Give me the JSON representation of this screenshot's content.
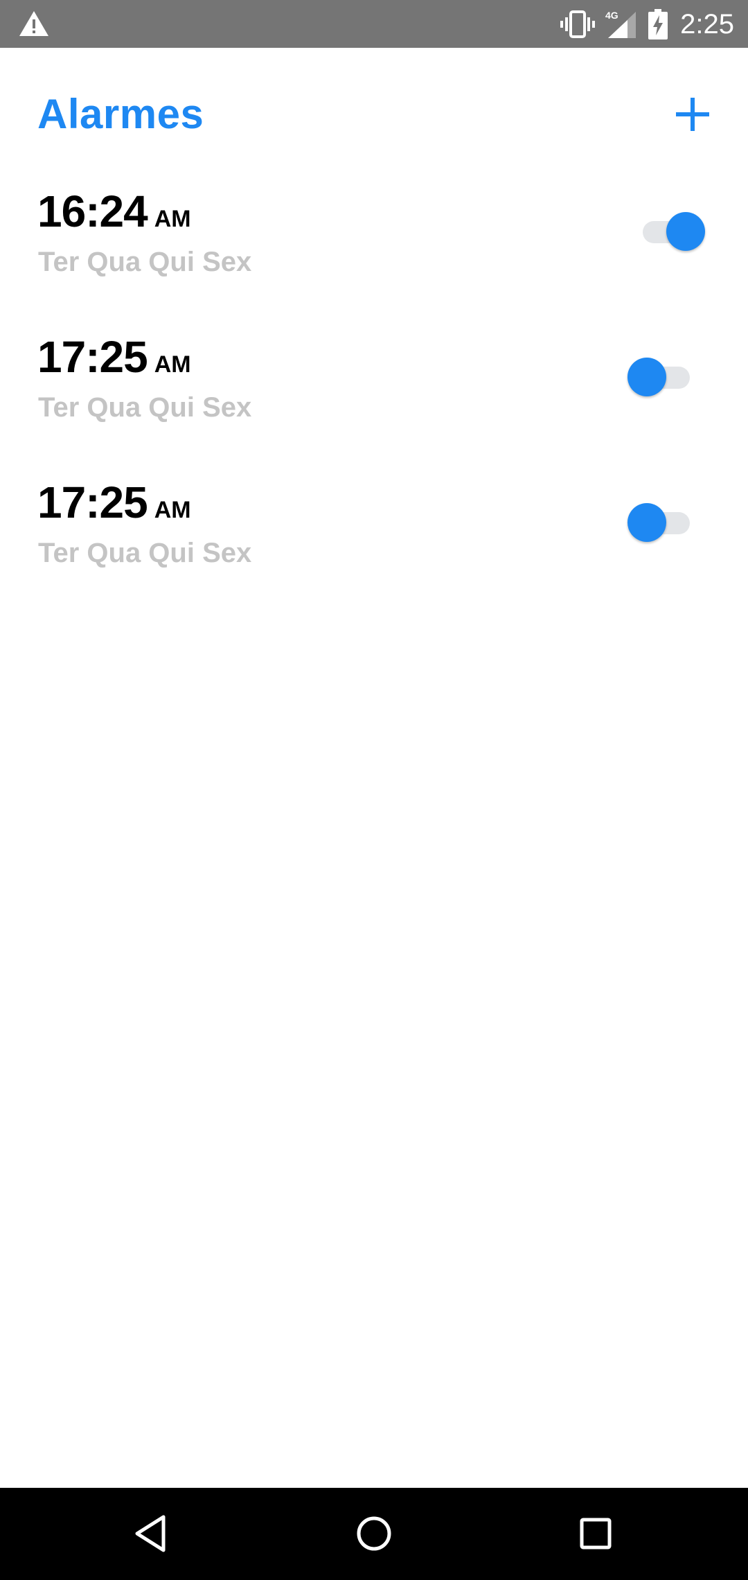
{
  "status_bar": {
    "time": "2:25",
    "network": "4G",
    "icons": [
      "warning-icon",
      "vibrate-icon",
      "signal-icon",
      "battery-charging-icon"
    ]
  },
  "header": {
    "title": "Alarmes",
    "add_icon": "plus-icon"
  },
  "alarms": [
    {
      "time": "16:24",
      "ampm": "AM",
      "days": "Ter Qua Qui Sex",
      "enabled": true
    },
    {
      "time": "17:25",
      "ampm": "AM",
      "days": "Ter Qua Qui Sex",
      "enabled": false
    },
    {
      "time": "17:25",
      "ampm": "AM",
      "days": "Ter Qua Qui Sex",
      "enabled": false
    }
  ],
  "nav_bar": {
    "icons": [
      "back-icon",
      "home-icon",
      "recents-icon"
    ]
  },
  "colors": {
    "accent": "#1e88f2",
    "status_bar": "#757575",
    "day_text": "#c4c4c4",
    "switch_track": "#e3e5e8"
  }
}
